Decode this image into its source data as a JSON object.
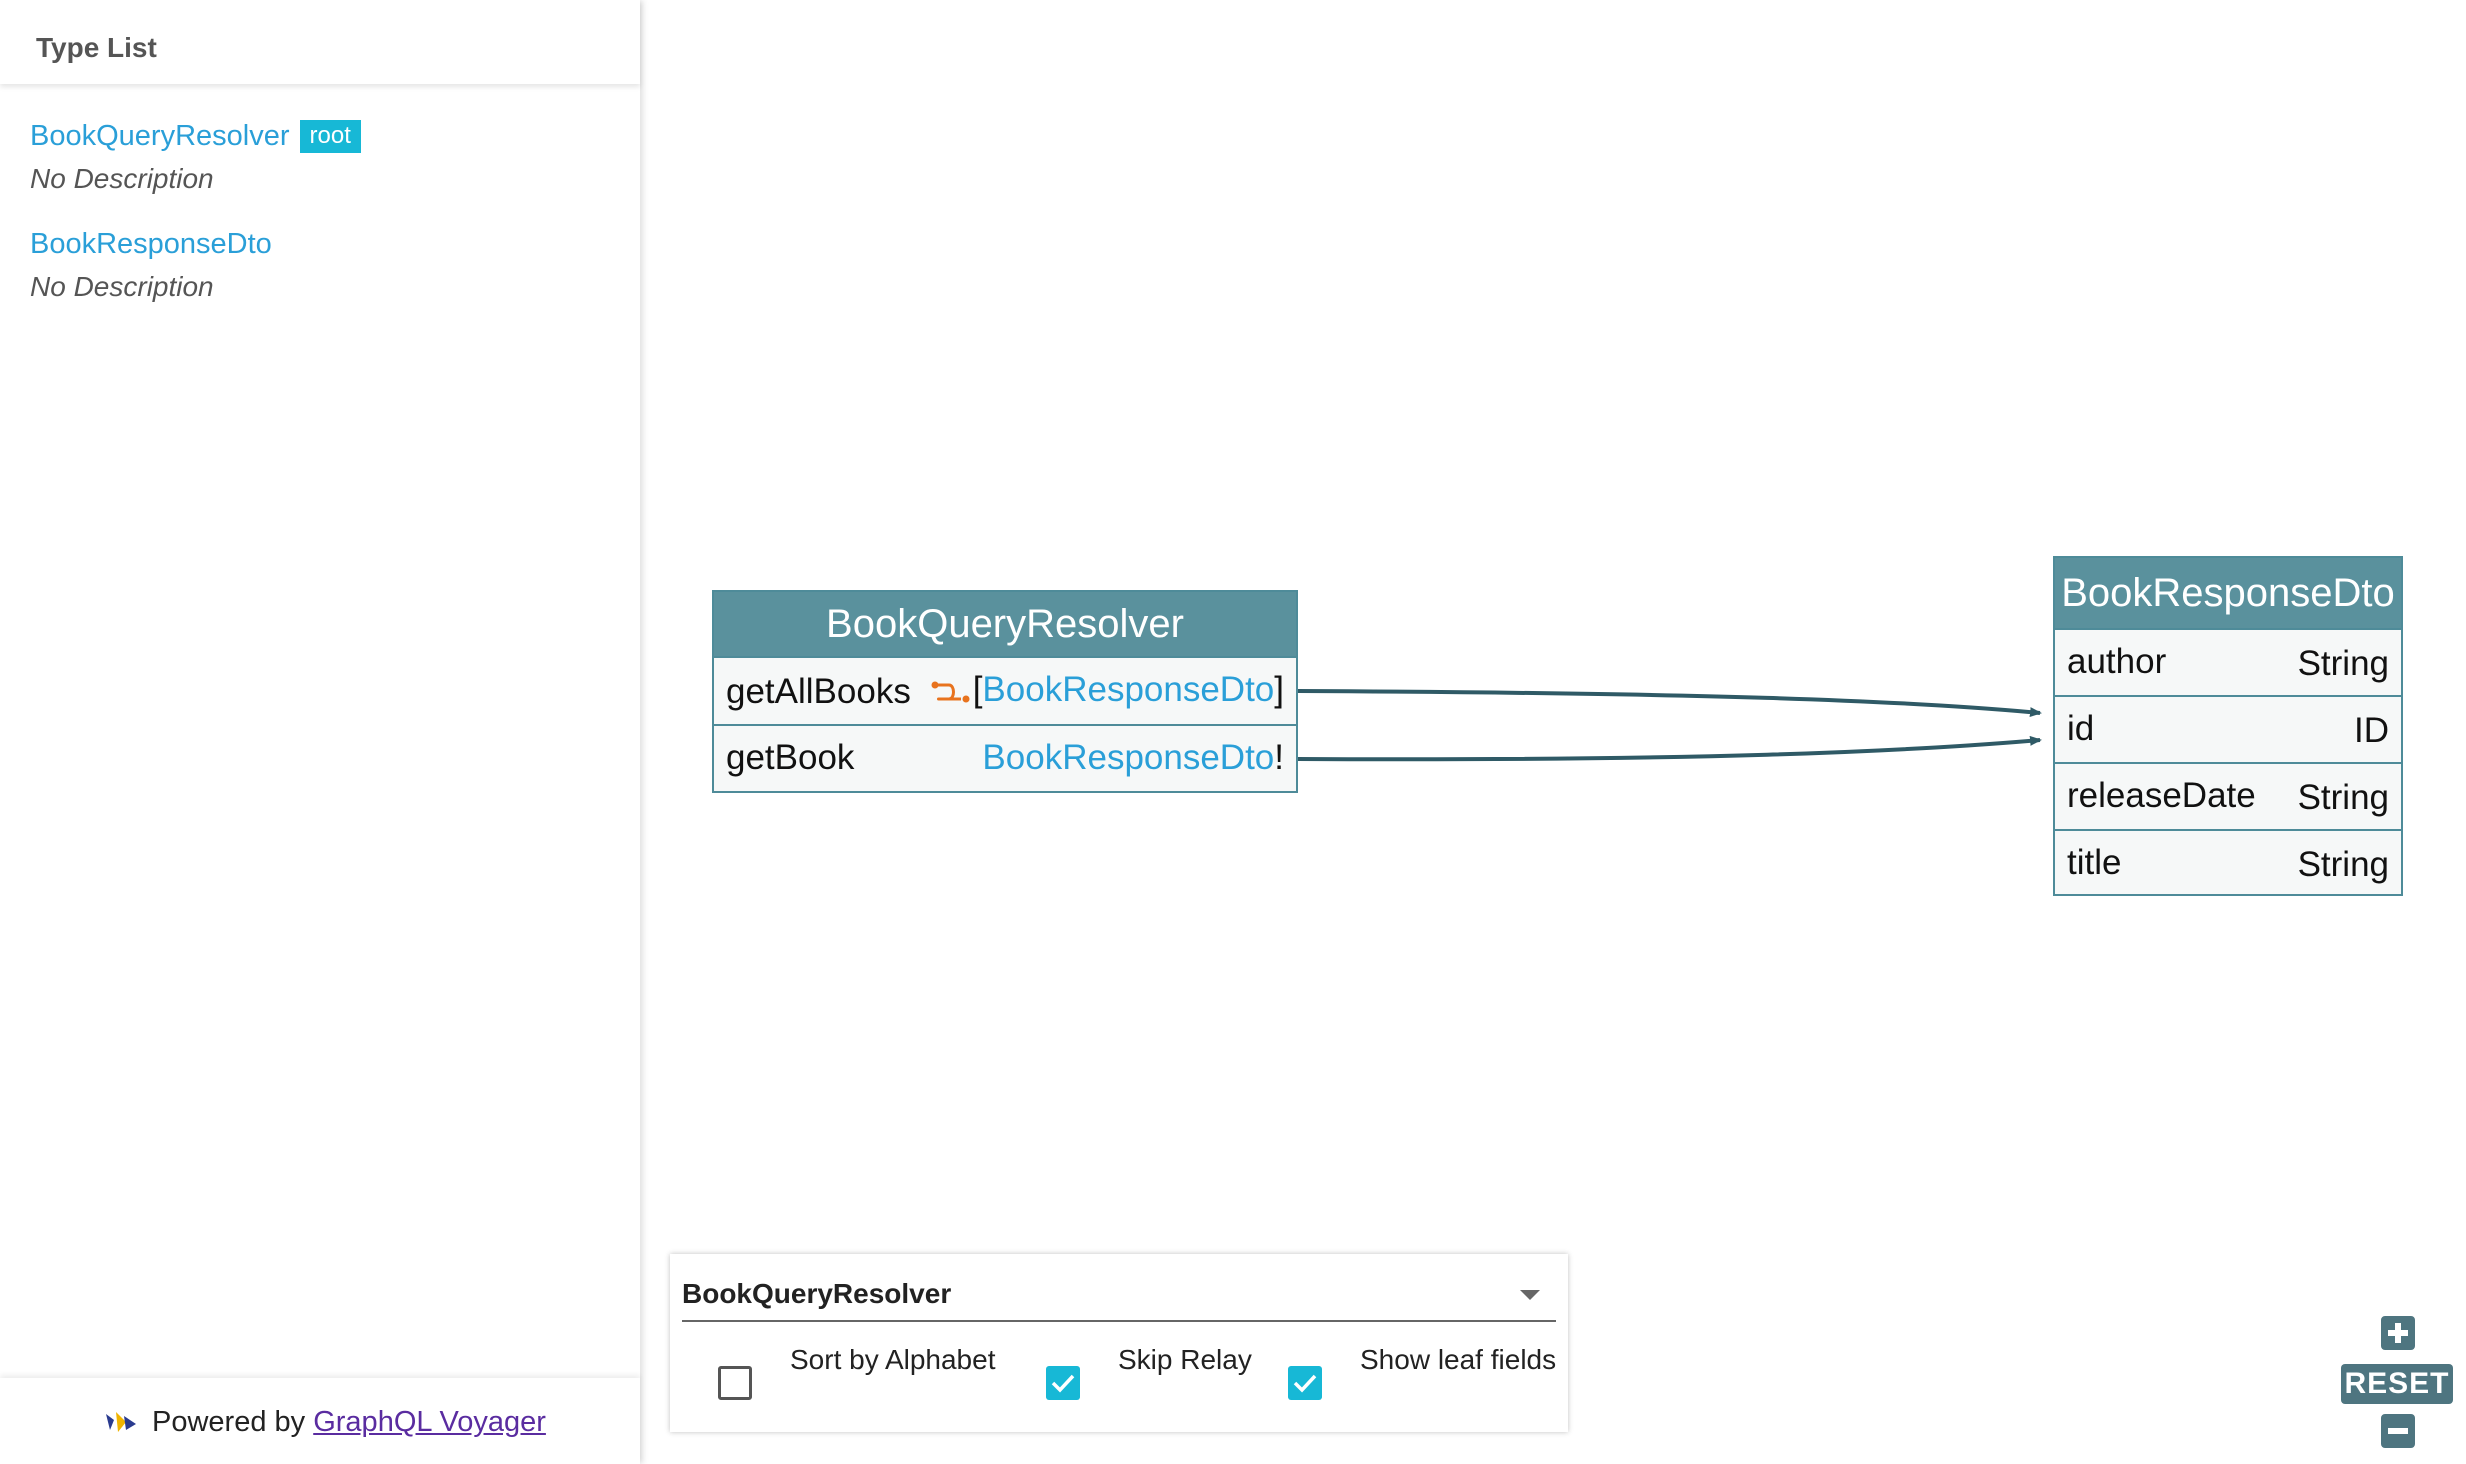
{
  "sidebar": {
    "title": "Type List",
    "types": [
      {
        "name": "BookQueryResolver",
        "badge": "root",
        "description": "No Description"
      },
      {
        "name": "BookResponseDto",
        "description": "No Description"
      }
    ],
    "footer": {
      "prefix": "Powered by",
      "link_text": "GraphQL Voyager"
    }
  },
  "graph": {
    "nodes": [
      {
        "title": "BookQueryResolver",
        "fields": [
          {
            "name": "getAllBooks",
            "relay_icon": "relay-connection-icon",
            "type_prefix": "[",
            "type": "BookResponseDto",
            "type_suffix": "]"
          },
          {
            "name": "getBook",
            "type_prefix": "",
            "type": "BookResponseDto",
            "type_suffix": "!"
          }
        ]
      },
      {
        "title": "BookResponseDto",
        "fields": [
          {
            "name": "author",
            "type": "String"
          },
          {
            "name": "id",
            "type": "ID"
          },
          {
            "name": "releaseDate",
            "type": "String"
          },
          {
            "name": "title",
            "type": "String"
          }
        ]
      }
    ]
  },
  "settings": {
    "selected_root": "BookQueryResolver",
    "options": [
      {
        "label": "Sort by Alphabet",
        "checked": false
      },
      {
        "label": "Skip Relay",
        "checked": true
      },
      {
        "label": "Show leaf fields",
        "checked": true
      }
    ]
  },
  "zoom": {
    "reset_label": "RESET",
    "zoom_in_icon": "plus-icon",
    "zoom_out_icon": "minus-icon"
  },
  "colors": {
    "accent": "#17b8d6",
    "link": "#2a9fd8",
    "node_header": "#5a919d",
    "node_border": "#4e8b99",
    "edge": "#2f5a66",
    "relay_icon": "#e8731e"
  }
}
